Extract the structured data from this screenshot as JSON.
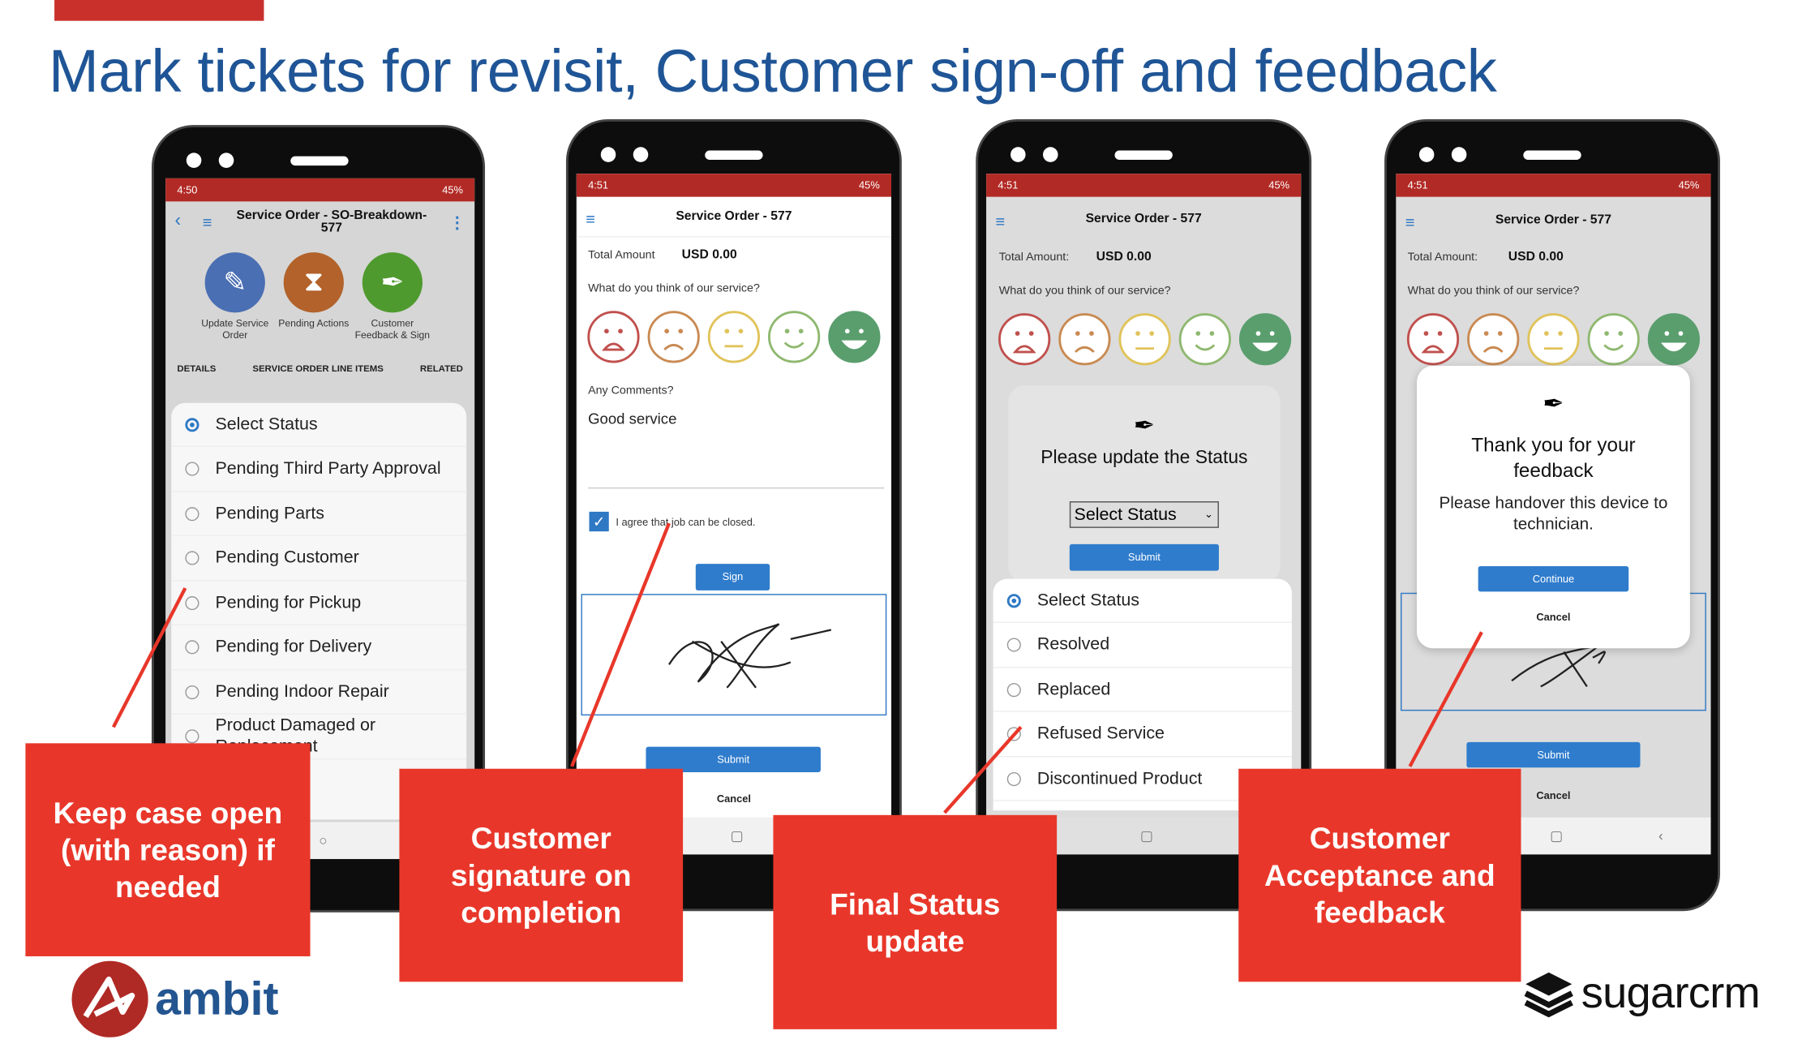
{
  "slide": {
    "title": "Mark tickets for revisit, Customer sign-off and feedback"
  },
  "phone1": {
    "time": "4:50",
    "battery": "45%",
    "header_title": "Service Order - SO-Breakdown-577",
    "actions": [
      {
        "label": "Update Service Order",
        "color": "#4a6fb3"
      },
      {
        "label": "Pending Actions",
        "color": "#b2622a"
      },
      {
        "label": "Customer Feedback & Sign",
        "color": "#4f9a2e"
      }
    ],
    "tabs": [
      "DETAILS",
      "SERVICE ORDER LINE ITEMS",
      "RELATED"
    ],
    "status_options": [
      "Select Status",
      "Pending Third Party Approval",
      "Pending Parts",
      "Pending Customer",
      "Pending for Pickup",
      "Pending for Delivery",
      "Pending Indoor Repair",
      "Product Damaged or Replacement"
    ],
    "selected_index": 0
  },
  "phone2": {
    "time": "4:51",
    "battery": "45%",
    "header_title": "Service Order - 577",
    "total_label": "Total Amount",
    "total_value": "USD 0.00",
    "question": "What do you think of our service?",
    "selected_rating": 5,
    "comments_label": "Any Comments?",
    "comments_value": "Good service",
    "agree_label": "I agree that job can be closed.",
    "agree_checked": true,
    "sign_label": "Sign",
    "submit_label": "Submit",
    "cancel_label": "Cancel"
  },
  "phone3": {
    "time": "4:51",
    "battery": "45%",
    "header_title": "Service Order - 577",
    "total_label": "Total Amount:",
    "total_value": "USD 0.00",
    "question": "What do you think of our service?",
    "modal_title": "Please update the Status",
    "select_value": "Select Status",
    "submit_label": "Submit",
    "status_options": [
      "Select Status",
      "Resolved",
      "Replaced",
      "Refused Service",
      "Discontinued Product"
    ],
    "selected_index": 0
  },
  "phone4": {
    "time": "4:51",
    "battery": "45%",
    "header_title": "Service Order - 577",
    "total_label": "Total Amount:",
    "total_value": "USD 0.00",
    "question": "What do you think of our service?",
    "modal_title": "Thank you for your feedback",
    "modal_text": "Please handover this device to technician.",
    "continue_label": "Continue",
    "modal_cancel_label": "Cancel",
    "submit_label": "Submit",
    "cancel_label": "Cancel"
  },
  "face_colors": [
    "#c0504d",
    "#c98a52",
    "#e0c35a",
    "#8fb870",
    "#5a9e6e"
  ],
  "callouts": [
    "Keep case open (with reason) if needed",
    "Customer signature on completion",
    "Final Status update",
    "Customer Acceptance and feedback"
  ],
  "logos": {
    "ambit": "ambit",
    "sugarcrm": "sugarcrm"
  },
  "colors": {
    "title": "#1f5596",
    "callout": "#e8372a",
    "status_bar": "#b22a25",
    "button": "#2f7ccc"
  }
}
